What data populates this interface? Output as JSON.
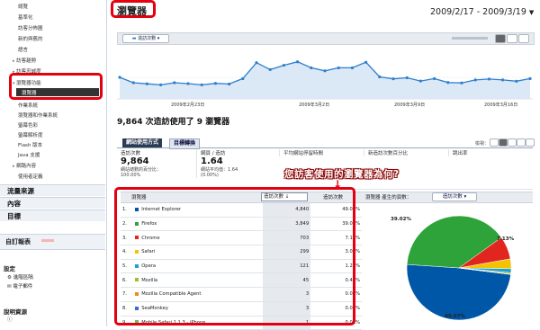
{
  "sidebar": {
    "items_top": [
      "總覽",
      "基準化",
      "訪客分佈圖",
      "新的與舊的",
      "語言"
    ],
    "collapsed_1": "訪客趨勢",
    "collapsed_2": "訪客忠誠度",
    "expanded": "瀏覽器功能",
    "selected": "瀏覽器",
    "sub_items": [
      "作業系統",
      "瀏覽器和作業系統",
      "螢幕色彩",
      "螢幕解析度",
      "Flash 版本",
      "Java 支援"
    ],
    "network": "網路內容",
    "custom": "使用者定義",
    "sections": [
      "流量來源",
      "內容",
      "目標"
    ],
    "custom_reports": "自訂報表",
    "settings_title": "設定",
    "settings_items": [
      "進階區隔",
      "電子郵件"
    ],
    "help_title": "說明資源"
  },
  "header": {
    "title": "瀏覽器",
    "date_range": "2009/2/17 - 2009/3/19"
  },
  "graph": {
    "metric": "造訪次數",
    "dates": [
      "2009年2月23日",
      "2009年3月2日",
      "2009年3月9日",
      "2009年3月16日"
    ],
    "values": [
      500,
      375,
      350,
      325,
      375,
      355,
      325,
      360,
      345,
      470,
      840,
      680,
      780,
      860,
      720,
      650,
      720,
      720,
      850,
      510,
      465,
      490,
      415,
      470,
      380,
      370,
      440,
      460,
      440,
      410,
      470
    ]
  },
  "summary": {
    "sentence": "9,864 次造訪使用了 9 瀏覽器"
  },
  "tabs": {
    "usage": "網站使用方式",
    "goal": "目標轉換",
    "view_label": "檢視："
  },
  "stats": [
    {
      "label": "造訪次數",
      "value": "9,864",
      "sub1": "網站總數的百分比：",
      "sub2": "100.00%"
    },
    {
      "label": "網頁 / 造訪",
      "value": "1.64",
      "sub1": "網站平均值：1.64",
      "sub2": "(0.00%)"
    },
    {
      "label": "平均網站停留時間"
    },
    {
      "label": "新造訪次數百分比"
    },
    {
      "label": "跳出率"
    }
  ],
  "overlay": "您訪客使用的瀏覽器為何?",
  "table": {
    "col_browser": "瀏覽器",
    "col_visits": "造訪次數",
    "col_visits_short": "造訪次數",
    "contrib_label": "瀏覽器 產生的頁數：",
    "contrib_select": "造訪次數",
    "rows": [
      {
        "n": "1.",
        "name": "Internet Explorer",
        "visits": "4,840",
        "pct": "49.07%",
        "color": "#0057a8"
      },
      {
        "n": "2.",
        "name": "Firefox",
        "visits": "3,849",
        "pct": "39.02%",
        "color": "#2ea33a"
      },
      {
        "n": "3.",
        "name": "Chrome",
        "visits": "703",
        "pct": "7.13%",
        "color": "#e0261f"
      },
      {
        "n": "4.",
        "name": "Safari",
        "visits": "299",
        "pct": "3.03%",
        "color": "#f3c200"
      },
      {
        "n": "5.",
        "name": "Opera",
        "visits": "121",
        "pct": "1.23%",
        "color": "#1c9fd7"
      },
      {
        "n": "6.",
        "name": "Mozilla",
        "visits": "45",
        "pct": "0.46%",
        "color": "#a0bf2a"
      },
      {
        "n": "7.",
        "name": "Mozilla Compatible Agent",
        "visits": "3",
        "pct": "0.03%",
        "color": "#ef8a1d"
      },
      {
        "n": "8.",
        "name": "SeaMonkey",
        "visits": "3",
        "pct": "0.03%",
        "color": "#3a6ad6"
      },
      {
        "n": "9.",
        "name": "Mobile Safari 1.1.3 - iPhone",
        "visits": "1",
        "pct": "0.01%",
        "color": "#58c558"
      }
    ]
  },
  "pie_labels": {
    "ie": "49.07%",
    "firefox": "39.02%",
    "chrome": "7.13%"
  },
  "pie_values": [
    49.07,
    39.02,
    7.13,
    3.03,
    1.23,
    0.46,
    0.03,
    0.03,
    0.01
  ],
  "colors": {
    "accent": "#e3000f"
  }
}
